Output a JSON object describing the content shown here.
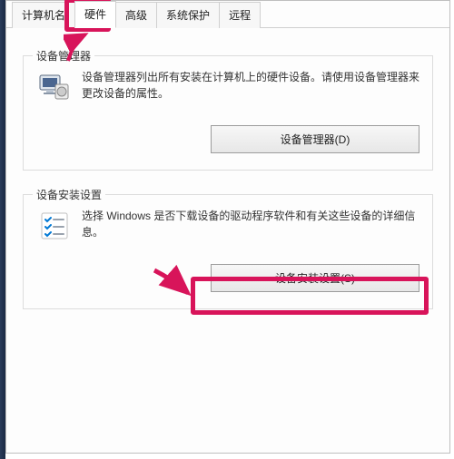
{
  "tabs": [
    {
      "label": "计算机名"
    },
    {
      "label": "硬件"
    },
    {
      "label": "高级"
    },
    {
      "label": "系统保护"
    },
    {
      "label": "远程"
    }
  ],
  "group1": {
    "title": "设备管理器",
    "description": "设备管理器列出所有安装在计算机上的硬件设备。请使用设备管理器来更改设备的属性。",
    "button": "设备管理器(D)"
  },
  "group2": {
    "title": "设备安装设置",
    "description": "选择 Windows 是否下载设备的驱动程序软件和有关这些设备的详细信息。",
    "button": "设备安装设置(S)"
  }
}
